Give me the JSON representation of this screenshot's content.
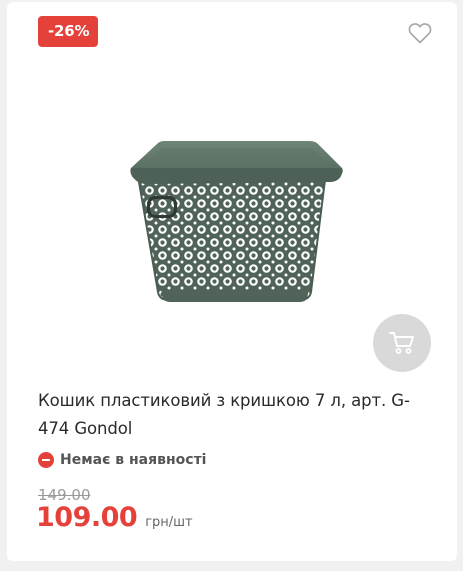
{
  "product": {
    "discount_badge": "-26%",
    "title": "Кошик пластиковий з кришкою 7 л, арт. G-474 Gondol",
    "availability": "Немає в наявності",
    "old_price": "149.00",
    "price": "109.00",
    "unit": "грн/шт",
    "image_icon": "storage-basket-with-lid",
    "favorite_icon": "heart-outline-icon",
    "cart_icon": "shopping-cart-icon"
  },
  "colors": {
    "accent": "#e5413b",
    "basket": "#5f7367",
    "cart_button_bg": "#d9d9d9"
  }
}
